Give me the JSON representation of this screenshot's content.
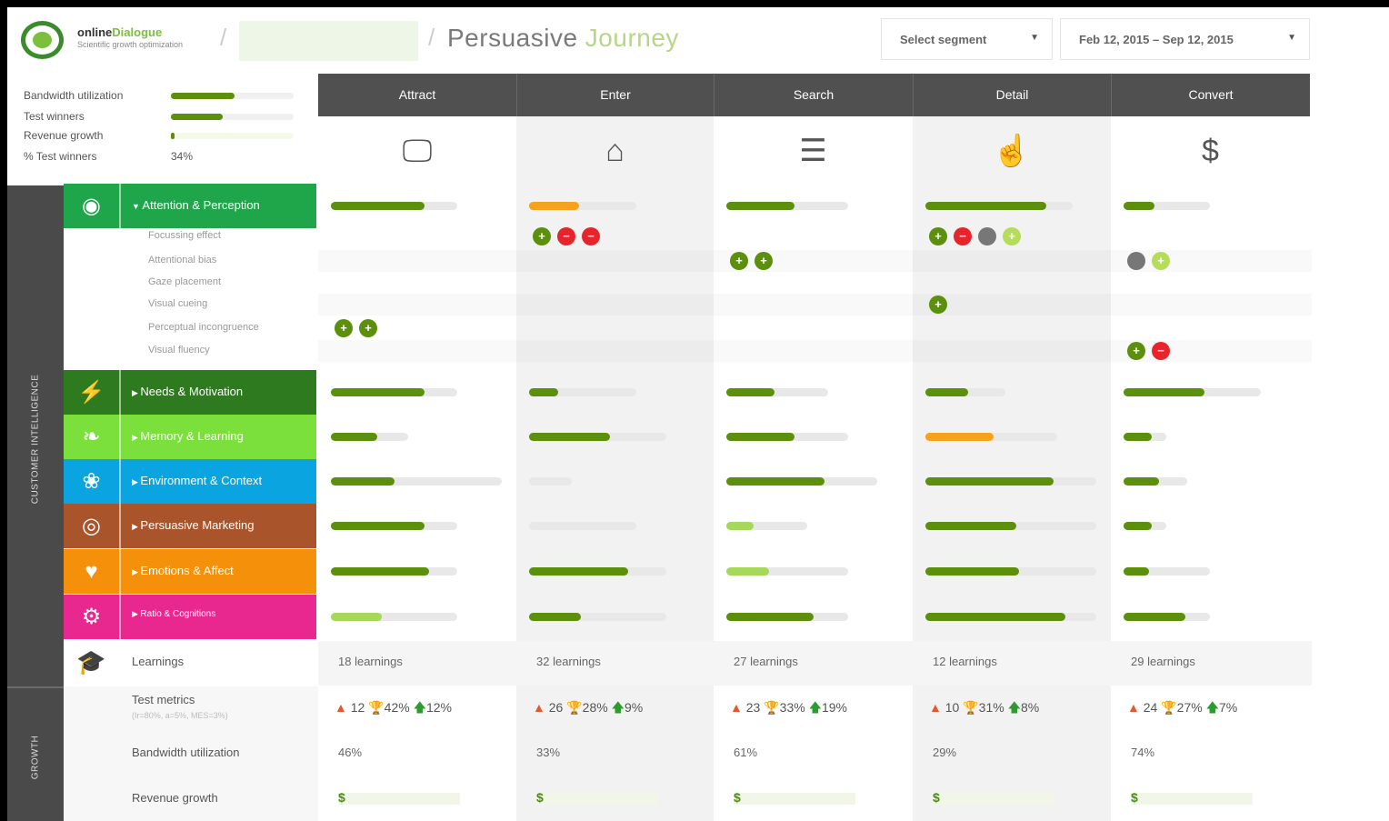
{
  "header": {
    "logo_name_a": "online",
    "logo_name_b": "Dialogue",
    "logo_tagline": "Scientific growth optimization",
    "title_a": "Persuasive ",
    "title_b": "Journey",
    "segment_label": "Select segment",
    "date_range": "Feb 12, 2015 – Sep 12, 2015"
  },
  "stats": [
    {
      "label": "Bandwidth utilization",
      "fill": 0.52
    },
    {
      "label": "Test winners",
      "fill": 0.42
    },
    {
      "label": "Revenue growth",
      "fill": 0.03
    },
    {
      "label": "% Test winners",
      "value": "34%"
    }
  ],
  "side": {
    "upper": "CUSTOMER INTELLIGENCE",
    "lower": "GROWTH"
  },
  "columns": [
    {
      "label": "Attract",
      "icon": "monitor-icon",
      "glyph": "🖵"
    },
    {
      "label": "Enter",
      "icon": "home-icon",
      "glyph": "⌂"
    },
    {
      "label": "Search",
      "icon": "list-icon",
      "glyph": "☰"
    },
    {
      "label": "Detail",
      "icon": "hand-pointer-icon",
      "glyph": "☝"
    },
    {
      "label": "Convert",
      "icon": "dollar-icon",
      "glyph": "$"
    }
  ],
  "categories": [
    {
      "label": "Attention & Perception",
      "color": "#1fa64a",
      "icon": "eye-icon",
      "glyph": "◉",
      "expanded": true
    },
    {
      "label": "Needs & Motivation",
      "color": "#2d7a1f",
      "icon": "lightning-icon",
      "glyph": "⚡"
    },
    {
      "label": "Memory & Learning",
      "color": "#7ce03c",
      "icon": "brain-icon",
      "glyph": "❧"
    },
    {
      "label": "Environment & Context",
      "color": "#0aa5e0",
      "icon": "globe-icon",
      "glyph": "❀"
    },
    {
      "label": "Persuasive Marketing",
      "color": "#a9542a",
      "icon": "target-icon",
      "glyph": "◎"
    },
    {
      "label": "Emotions & Affect",
      "color": "#f5900a",
      "icon": "heart-icon",
      "glyph": "♥"
    },
    {
      "label": "Ratio & Cognitions",
      "color": "#e8278f",
      "icon": "gears-icon",
      "glyph": "⚙"
    }
  ],
  "subcategories": [
    "Focussing effect",
    "Attentional bias",
    "Gaze placement",
    "Visual cueing",
    "Perceptual incongruence",
    "Visual fluency"
  ],
  "colors": {
    "green": "#5b8f0c",
    "light_green": "#a6d85a",
    "orange": "#f7a21b",
    "red": "#e8242b",
    "grey": "#777777",
    "lime": "#b5dc5a"
  },
  "growth": {
    "learnings_label": "Learnings",
    "metrics_label": "Test metrics",
    "metrics_sub": "(Ir=80%, a=5%, MES=3%)",
    "bandwidth_label": "Bandwidth utilization",
    "revenue_label": "Revenue growth",
    "learnings": [
      "18 learnings",
      "32 learnings",
      "27 learnings",
      "12 learnings",
      "29 learnings"
    ],
    "tests": [
      "12",
      "26",
      "23",
      "10",
      "24"
    ],
    "wins": [
      "42%",
      "28%",
      "33%",
      "31%",
      "27%"
    ],
    "uplift": [
      "12%",
      "9%",
      "19%",
      "8%",
      "7%"
    ],
    "bandwidth": [
      "46%",
      "33%",
      "61%",
      "29%",
      "74%"
    ],
    "revenue_symbol": "$"
  },
  "grid": {
    "row_bars": [
      [
        {
          "w": 0.74,
          "f": 0.74,
          "c": "green"
        },
        {
          "w": 0.63,
          "f": 0.47,
          "c": "orange"
        },
        {
          "w": 0.71,
          "f": 0.56,
          "c": "green"
        },
        {
          "w": 0.86,
          "f": 0.82,
          "c": "green"
        },
        {
          "w": 0.5,
          "f": 0.36,
          "c": "green"
        }
      ],
      [
        {
          "w": 0.74,
          "f": 0.74,
          "c": "green"
        },
        {
          "w": 0.63,
          "f": 0.27,
          "c": "green"
        },
        {
          "w": 0.59,
          "f": 0.47,
          "c": "green"
        },
        {
          "w": 0.47,
          "f": 0.53,
          "c": "green"
        },
        {
          "w": 0.8,
          "f": 0.59,
          "c": "green"
        }
      ],
      [
        {
          "w": 0.45,
          "f": 0.6,
          "c": "green"
        },
        {
          "w": 0.81,
          "f": 0.59,
          "c": "green"
        },
        {
          "w": 0.71,
          "f": 0.56,
          "c": "green"
        },
        {
          "w": 0.77,
          "f": 0.52,
          "c": "orange"
        },
        {
          "w": 0.25,
          "f": 0.67,
          "c": "green"
        }
      ],
      [
        {
          "w": 1.0,
          "f": 0.37,
          "c": "green"
        },
        {
          "w": 0.25,
          "f": 0.0,
          "c": "green"
        },
        {
          "w": 0.88,
          "f": 0.65,
          "c": "green"
        },
        {
          "w": 1.0,
          "f": 0.75,
          "c": "green"
        },
        {
          "w": 0.37,
          "f": 0.56,
          "c": "green"
        }
      ],
      [
        {
          "w": 0.74,
          "f": 0.74,
          "c": "green"
        },
        {
          "w": 0.63,
          "f": 0.0,
          "c": "green"
        },
        {
          "w": 0.47,
          "f": 0.34,
          "c": "light_green"
        },
        {
          "w": 1.0,
          "f": 0.53,
          "c": "green"
        },
        {
          "w": 0.25,
          "f": 0.67,
          "c": "green"
        }
      ],
      [
        {
          "w": 0.74,
          "f": 0.78,
          "c": "green"
        },
        {
          "w": 0.81,
          "f": 0.72,
          "c": "green"
        },
        {
          "w": 0.71,
          "f": 0.35,
          "c": "light_green"
        },
        {
          "w": 1.0,
          "f": 0.55,
          "c": "green"
        },
        {
          "w": 0.5,
          "f": 0.29,
          "c": "green"
        }
      ],
      [
        {
          "w": 0.74,
          "f": 0.4,
          "c": "light_green"
        },
        {
          "w": 0.81,
          "f": 0.38,
          "c": "green"
        },
        {
          "w": 0.71,
          "f": 0.72,
          "c": "green"
        },
        {
          "w": 1.0,
          "f": 0.82,
          "c": "green"
        },
        {
          "w": 0.5,
          "f": 0.72,
          "c": "green"
        }
      ]
    ],
    "dots": [
      {
        "sub": 0,
        "col": 1,
        "items": [
          "green",
          "red",
          "red"
        ]
      },
      {
        "sub": 0,
        "col": 3,
        "items": [
          "green",
          "red",
          "grey",
          "lime"
        ]
      },
      {
        "sub": 1,
        "col": 2,
        "items": [
          "green",
          "green"
        ]
      },
      {
        "sub": 1,
        "col": 4,
        "items": [
          "grey",
          "lime"
        ]
      },
      {
        "sub": 3,
        "col": 3,
        "items": [
          "green"
        ]
      },
      {
        "sub": 4,
        "col": 0,
        "items": [
          "green",
          "green"
        ]
      },
      {
        "sub": 5,
        "col": 4,
        "items": [
          "green",
          "red"
        ]
      }
    ]
  }
}
